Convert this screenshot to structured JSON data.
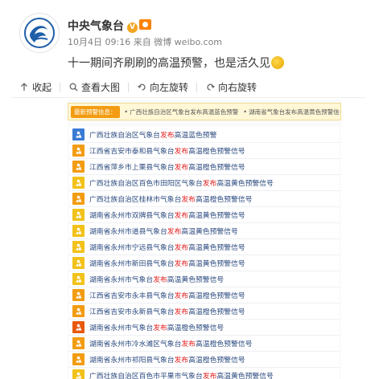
{
  "post": {
    "author": "中央气象台",
    "meta": "10月4日 09:16 来自 微博 weibo.com",
    "text": "十一期间齐刷刷的高温预警，也是活久见",
    "colors": {
      "verified": "#f2a520",
      "member": "#ff8200"
    }
  },
  "toolbar": {
    "collapse": "收起",
    "view_large": "查看大图",
    "rotate_left": "向左旋转",
    "rotate_right": "向右旋转"
  },
  "latest_warnings": {
    "tag": "最新预警信息：",
    "items": [
      "• 广西壮族自治区气象台发布高温蓝色预警",
      "• 湖南省气象台发布高温黄色预警信号"
    ]
  },
  "alerts": [
    {
      "before": "广西壮族自治区气象台",
      "verb": "发布",
      "after": "高温蓝色预警",
      "color": "#3a7bd5"
    },
    {
      "before": "江西省吉安市泰和县气象台",
      "verb": "发布",
      "after": "高温橙色预警信号",
      "color": "#f39c12"
    },
    {
      "before": "江西省萍乡市上栗县气象台",
      "verb": "发布",
      "after": "高温橙色预警信号",
      "color": "#f39c12"
    },
    {
      "before": "广西壮族自治区百色市田阳区气象台",
      "verb": "发布",
      "after": "高温黄色预警信号",
      "color": "#f2c21a"
    },
    {
      "before": "广西壮族自治区桂林市气象台",
      "verb": "发布",
      "after": "高温橙色预警信号",
      "color": "#f39c12"
    },
    {
      "before": "湖南省永州市双牌县气象台",
      "verb": "发布",
      "after": "高温黄色预警信号",
      "color": "#f2c21a"
    },
    {
      "before": "湖南省永州市道县气象台",
      "verb": "发布",
      "after": "高温黄色预警信号",
      "color": "#f2c21a"
    },
    {
      "before": "湖南省永州市宁远县气象台",
      "verb": "发布",
      "after": "高温黄色预警信号",
      "color": "#f2c21a"
    },
    {
      "before": "湖南省永州市新田县气象台",
      "verb": "发布",
      "after": "高温黄色预警信号",
      "color": "#f2c21a"
    },
    {
      "before": "湖南省永州市气象台",
      "verb": "发布",
      "after": "高温黄色预警信号",
      "color": "#f2c21a"
    },
    {
      "before": "江西省吉安市永丰县气象台",
      "verb": "发布",
      "after": "高温橙色预警信号",
      "color": "#f39c12"
    },
    {
      "before": "江西省吉安市永新县气象台",
      "verb": "发布",
      "after": "高温橙色预警信号",
      "color": "#f39c12"
    },
    {
      "before": "湖南省永州市气象台",
      "verb": "发布",
      "after": "高温橙色预警信号",
      "color": "#e8590c"
    },
    {
      "before": "湖南省永州市冷水滩区气象台",
      "verb": "发布",
      "after": "高温橙色预警信号",
      "color": "#f39c12"
    },
    {
      "before": "湖南省永州市祁阳县气象台",
      "verb": "发布",
      "after": "高温橙色预警信号",
      "color": "#f39c12"
    },
    {
      "before": "广西壮族自治区百色市平果市气象台",
      "verb": "发布",
      "after": "高温黄色预警信号",
      "color": "#f2c21a"
    }
  ]
}
